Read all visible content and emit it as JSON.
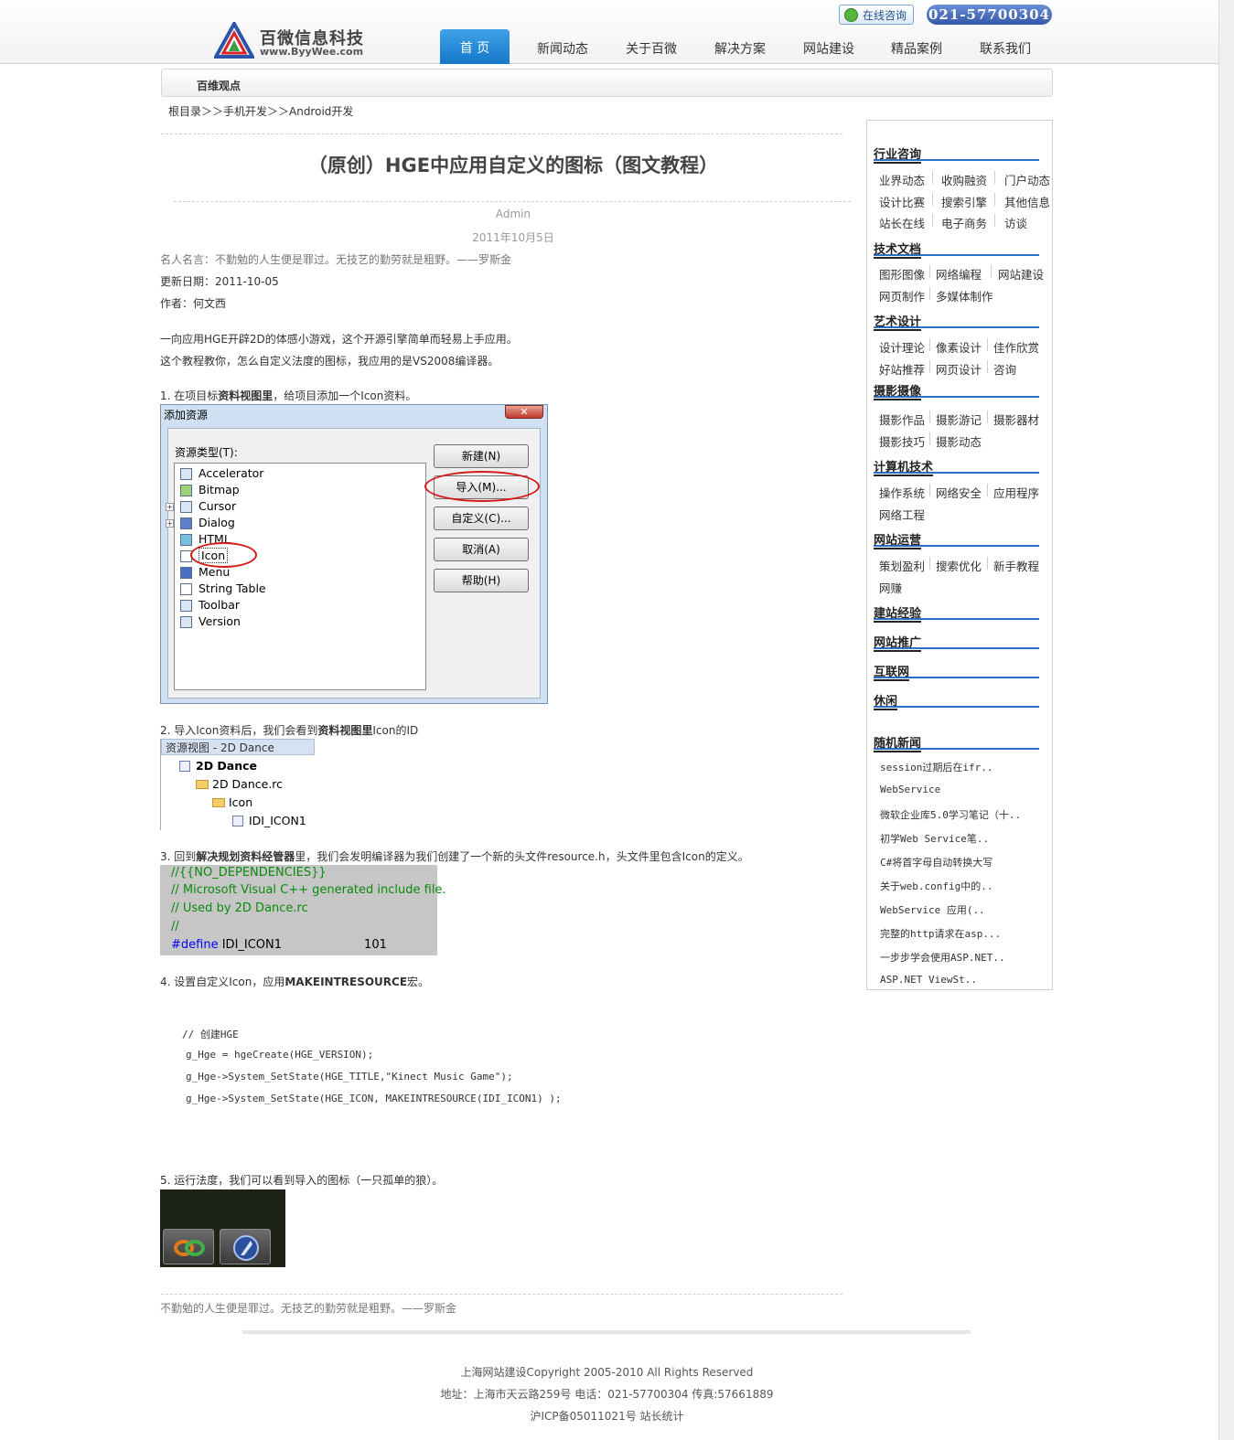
{
  "header": {
    "logo_cn": "百微信息科技",
    "logo_url": "www.ByyWee.com",
    "consult_label": "在线咨询",
    "phone": "021-57700304",
    "nav": [
      "首 页",
      "新闻动态",
      "关于百微",
      "解决方案",
      "网站建设",
      "精品案例",
      "联系我们"
    ],
    "active_nav": "首 页"
  },
  "section_bar": {
    "label": "百维观点"
  },
  "breadcrumb": "根目录＞＞手机开发＞＞Android开发",
  "article": {
    "title": "（原创）HGE中应用自定义的图标（图文教程）",
    "author": "Admin",
    "date": "2011年10月5日",
    "quote": "名人名言：不勤勉的人生便是罪过。无技艺的勤劳就是粗野。——罗斯金",
    "update_date": "更新日期：2011-10-05",
    "author_line": "作者：何文西",
    "intro_1": "一向应用HGE开辟2D的体感小游戏，这个开源引擎简单而轻易上手应用。",
    "intro_2": "这个教程教你，怎么自定义法度的图标，我应用的是VS2008编译器。",
    "step1_a": "1. 在项目标",
    "step1_b": "资料视图里",
    "step1_c": "，给项目添加一个Icon资料。",
    "step2_a": "2. 导入Icon资料后，我们会看到",
    "step2_b": "资料视图里",
    "step2_c": "Icon的ID",
    "step3_a": "3. 回到",
    "step3_b": "解决规划资料经管器",
    "step3_c": "里，我们会发明编译器为我们创建了一个新的头文件resource.h，头文件里包含Icon的定义。",
    "step4_a": "4. 设置自定义Icon，应用",
    "step4_b": "MAKEINTRESOURCE",
    "step4_c": "宏。",
    "code": [
      "// 创建HGE",
      "g_Hge = hgeCreate(HGE_VERSION);",
      "g_Hge->System_SetState(HGE_TITLE,\"Kinect Music Game\");",
      "g_Hge->System_SetState(HGE_ICON, MAKEINTRESOURCE(IDI_ICON1) );"
    ],
    "step5": "5. 运行法度，我们可以看到导入的图标（一只孤单的狼）。",
    "closing_quote": "不勤勉的人生便是罪过。无技艺的勤劳就是粗野。——罗斯金"
  },
  "dialog_screenshot": {
    "title": "添加资源",
    "close": "✕",
    "resource_type_label": "资源类型(T):",
    "types": [
      "Accelerator",
      "Bitmap",
      "Cursor",
      "Dialog",
      "HTML",
      "Icon",
      "Menu",
      "String Table",
      "Toolbar",
      "Version"
    ],
    "buttons": [
      "新建(N)",
      "导入(M)...",
      "自定义(C)...",
      "取消(A)",
      "帮助(H)"
    ]
  },
  "resource_view_screenshot": {
    "title": "资源视图 - 2D Dance",
    "root": "2D Dance",
    "rc": "2D Dance.rc",
    "folder": "Icon",
    "id": "IDI_ICON1"
  },
  "code_screenshot": {
    "line1": "//{{NO_DEPENDENCIES}}",
    "line2": "// Microsoft Visual C++ generated include file.",
    "line3": "// Used by 2D Dance.rc",
    "line4": "//",
    "define_kw": "#define",
    "define_name": "IDI_ICON1",
    "define_val": "101"
  },
  "sidebar": {
    "categories": [
      {
        "title": "行业咨询",
        "links": [
          "业界动态",
          "收购融资",
          "门户动态",
          "设计比赛",
          "搜索引擎",
          "其他信息",
          "站长在线",
          "电子商务",
          "访谈"
        ]
      },
      {
        "title": "技术文档",
        "links": [
          "图形图像",
          "网络编程",
          "网站建设",
          "网页制作",
          "多媒体制作"
        ]
      },
      {
        "title": "艺术设计",
        "links": [
          "设计理论",
          "像素设计",
          "佳作欣赏",
          "好站推荐",
          "网页设计",
          "咨询"
        ]
      },
      {
        "title": "摄影摄像",
        "links": [
          "摄影作品",
          "摄影游记",
          "摄影器材",
          "摄影技巧",
          "摄影动态"
        ]
      },
      {
        "title": "计算机技术",
        "links": [
          "操作系统",
          "网络安全",
          "应用程序",
          "网络工程"
        ]
      },
      {
        "title": "网站运营",
        "links": [
          "策划盈利",
          "搜索优化",
          "新手教程",
          "网赚"
        ]
      },
      {
        "title": "建站经验",
        "links": []
      },
      {
        "title": "网站推广",
        "links": []
      },
      {
        "title": "互联网",
        "links": []
      },
      {
        "title": "休闲",
        "links": []
      }
    ],
    "random_news_title": "随机新闻",
    "random_news": [
      "session过期后在ifr..",
      "WebService",
      "微软企业库5.0学习笔记（十..",
      "初学Web Service笔..",
      "C#将首字母自动转换大写",
      "关于web.config中的..",
      "WebService 应用(..",
      "完整的http请求在asp...",
      "一步步学会使用ASP.NET..",
      "ASP.NET ViewSt.."
    ]
  },
  "footer": {
    "line1": "上海网站建设Copyright 2005-2010 All Rights Reserved",
    "line2": "地址：上海市天云路259号 电话：021-57700304  传真:57661889",
    "line3": "沪ICP备05011021号  站长统计"
  }
}
